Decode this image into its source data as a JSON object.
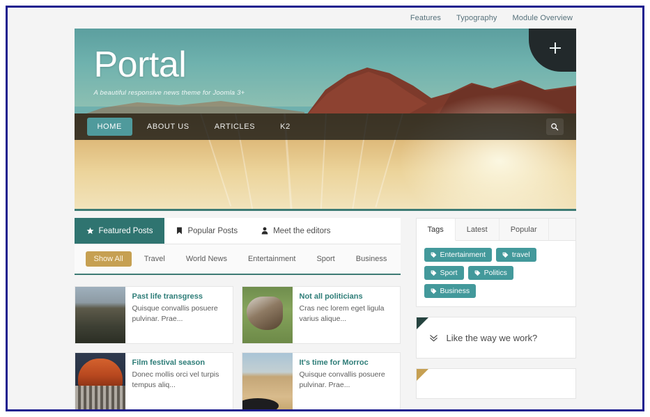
{
  "topnav": {
    "links": [
      {
        "label": "Features"
      },
      {
        "label": "Typography"
      },
      {
        "label": "Module Overview"
      }
    ]
  },
  "hero": {
    "logo": "Portal",
    "tagline": "A beautiful responsive news theme for Joomla 3+",
    "plus_icon": "plus-icon",
    "search_icon": "search-icon"
  },
  "menu": {
    "items": [
      {
        "label": "HOME",
        "active": true
      },
      {
        "label": "ABOUT US",
        "active": false
      },
      {
        "label": "ARTICLES",
        "active": false
      },
      {
        "label": "K2",
        "active": false
      }
    ]
  },
  "tabs": [
    {
      "label": "Featured Posts",
      "icon": "star-icon",
      "active": true
    },
    {
      "label": "Popular Posts",
      "icon": "bookmark-icon",
      "active": false
    },
    {
      "label": "Meet the editors",
      "icon": "person-icon",
      "active": false
    }
  ],
  "filters": [
    {
      "label": "Show All",
      "active": true
    },
    {
      "label": "Travel",
      "active": false
    },
    {
      "label": "World News",
      "active": false
    },
    {
      "label": "Entertainment",
      "active": false
    },
    {
      "label": "Sport",
      "active": false
    },
    {
      "label": "Business",
      "active": false
    }
  ],
  "articles": [
    {
      "title": "Past life transgress",
      "excerpt": "Quisque convallis posuere pulvinar. Prae...",
      "thumb": "cliff-monastery-photo"
    },
    {
      "title": "Not all politicians",
      "excerpt": "Cras nec lorem eget ligula varius alique...",
      "thumb": "donkey-photo"
    },
    {
      "title": "Film festival season",
      "excerpt": "Donec mollis orci vel turpis tempus aliq...",
      "thumb": "festival-stage-photo"
    },
    {
      "title": "It's time for Morroc",
      "excerpt": "Quisque convallis posuere pulvinar. Prae...",
      "thumb": "desert-road-photo"
    }
  ],
  "sidebar": {
    "tabs": [
      {
        "label": "Tags",
        "active": true
      },
      {
        "label": "Latest",
        "active": false
      },
      {
        "label": "Popular",
        "active": false
      }
    ],
    "tags": [
      {
        "label": "Entertainment"
      },
      {
        "label": "travel"
      },
      {
        "label": "Sport"
      },
      {
        "label": "Politics"
      },
      {
        "label": "Business"
      }
    ],
    "collapse_module": {
      "title": "Like the way we work?",
      "icon": "double-chevron-down-icon"
    }
  },
  "colors": {
    "frame_border": "#1b1b8f",
    "teal_accent": "#4f9a9c",
    "tab_active": "#2f7470",
    "gold_accent": "#c6a052",
    "tag_bg": "#43999b",
    "card_title": "#2e7d78",
    "menubar_bg": "#161614"
  }
}
